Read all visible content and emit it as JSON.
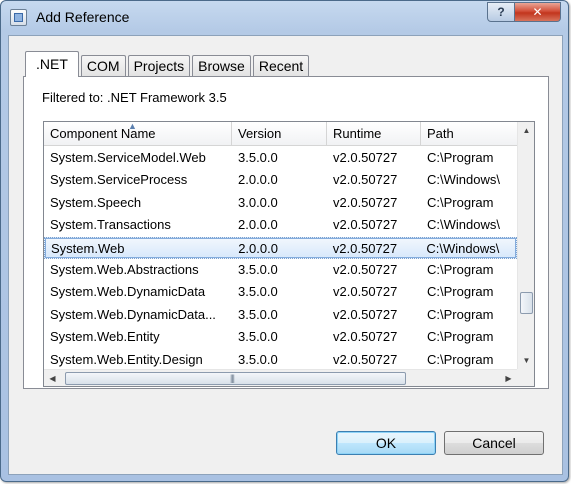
{
  "window": {
    "title": "Add Reference"
  },
  "titlebar_buttons": {
    "help": "?",
    "close": "✕"
  },
  "tabs": [
    {
      "label": ".NET",
      "active": true
    },
    {
      "label": "COM",
      "active": false
    },
    {
      "label": "Projects",
      "active": false
    },
    {
      "label": "Browse",
      "active": false
    },
    {
      "label": "Recent",
      "active": false
    }
  ],
  "filter_text": "Filtered to: .NET Framework 3.5",
  "list": {
    "columns": [
      "Component Name",
      "Version",
      "Runtime",
      "Path"
    ],
    "sorted_by": "Component Name",
    "rows": [
      [
        "System.ServiceModel.Web",
        "3.5.0.0",
        "v2.0.50727",
        "C:\\Program"
      ],
      [
        "System.ServiceProcess",
        "2.0.0.0",
        "v2.0.50727",
        "C:\\Windows\\"
      ],
      [
        "System.Speech",
        "3.0.0.0",
        "v2.0.50727",
        "C:\\Program"
      ],
      [
        "System.Transactions",
        "2.0.0.0",
        "v2.0.50727",
        "C:\\Windows\\"
      ],
      [
        "System.Web",
        "2.0.0.0",
        "v2.0.50727",
        "C:\\Windows\\"
      ],
      [
        "System.Web.Abstractions",
        "3.5.0.0",
        "v2.0.50727",
        "C:\\Program"
      ],
      [
        "System.Web.DynamicData",
        "3.5.0.0",
        "v2.0.50727",
        "C:\\Program"
      ],
      [
        "System.Web.DynamicData...",
        "3.5.0.0",
        "v2.0.50727",
        "C:\\Program"
      ],
      [
        "System.Web.Entity",
        "3.5.0.0",
        "v2.0.50727",
        "C:\\Program"
      ],
      [
        "System.Web.Entity.Design",
        "3.5.0.0",
        "v2.0.50727",
        "C:\\Program"
      ]
    ],
    "selected_index": 4
  },
  "buttons": {
    "ok": "OK",
    "cancel": "Cancel"
  },
  "icons": {
    "app": "reference-dialog-icon",
    "sort": "sort-ascending-icon"
  }
}
